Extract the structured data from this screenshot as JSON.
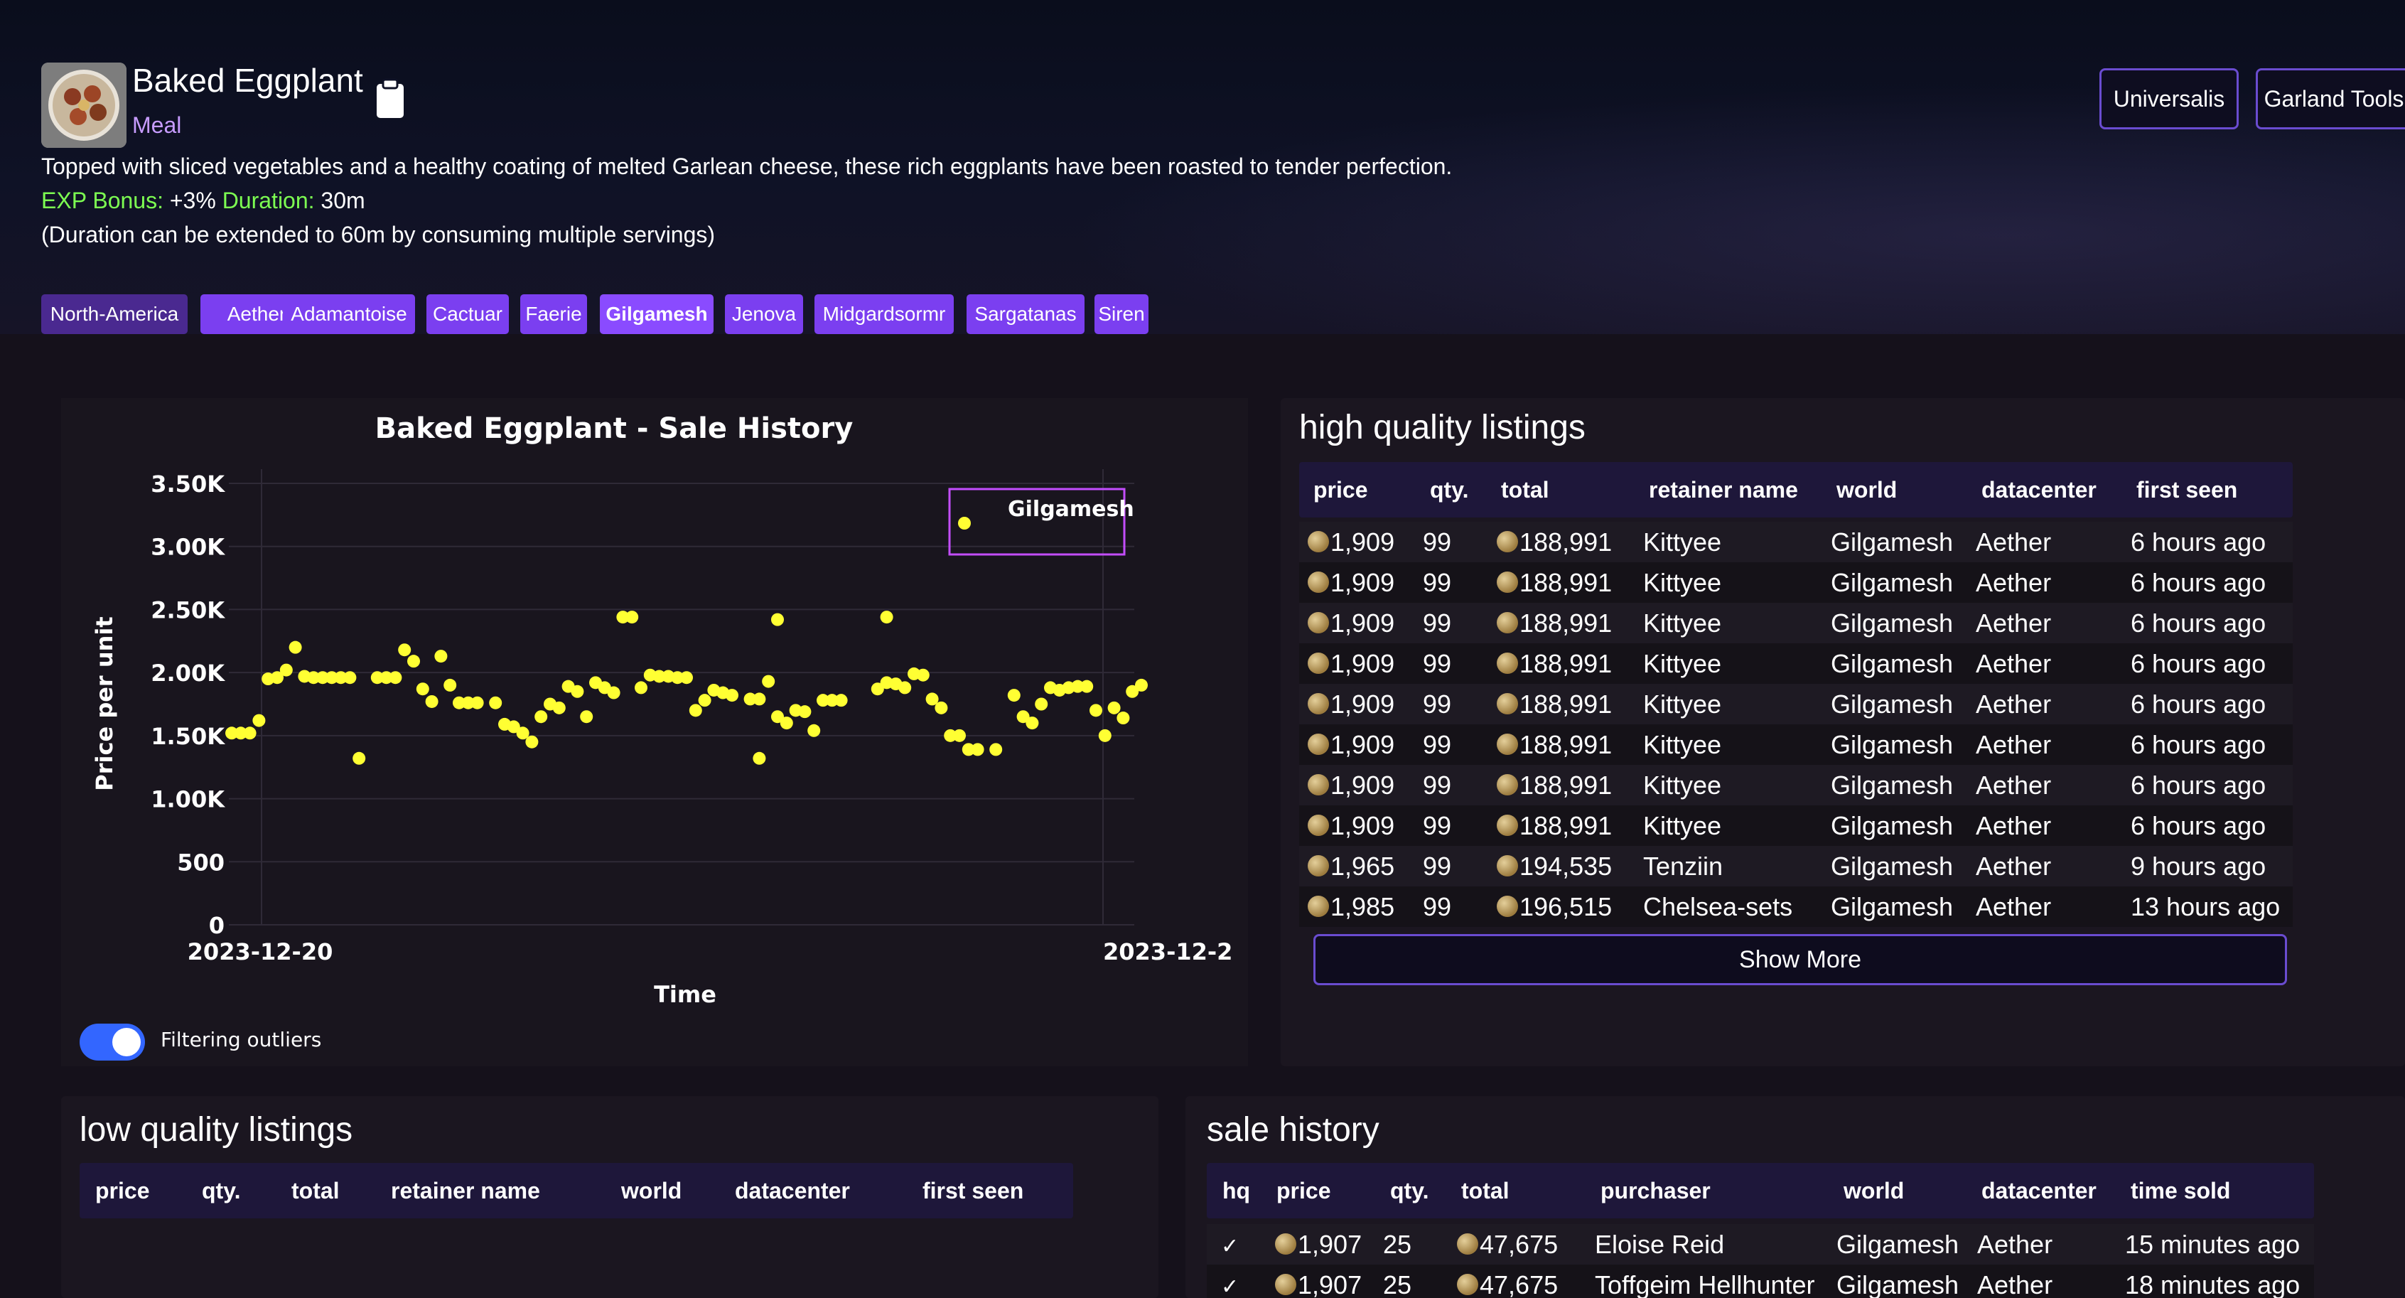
{
  "item": {
    "name": "Baked Eggplant",
    "category": "Meal",
    "description": "Topped with sliced vegetables and a healthy coating of melted Garlean cheese, these rich eggplants have been roasted to tender perfection.",
    "exp_label": "EXP Bonus:",
    "exp_value": "+3%",
    "duration_label": "Duration:",
    "duration_value": "30m",
    "duration_note": "(Duration can be extended to 60m by consuming multiple servings)"
  },
  "external_links": [
    "Universalis",
    "Garland Tools"
  ],
  "worlds": [
    {
      "label": "North-America",
      "variant": "dark"
    },
    {
      "label": "Aether",
      "variant": "normal"
    },
    {
      "label": "Adamantoise",
      "variant": "normal"
    },
    {
      "label": "Cactuar",
      "variant": "normal"
    },
    {
      "label": "Faerie",
      "variant": "normal"
    },
    {
      "label": "Gilgamesh",
      "variant": "active"
    },
    {
      "label": "Jenova",
      "variant": "normal"
    },
    {
      "label": "Midgardsormr",
      "variant": "normal"
    },
    {
      "label": "Sargatanas",
      "variant": "normal"
    },
    {
      "label": "Siren",
      "variant": "normal"
    }
  ],
  "chart": {
    "title": "Baked Eggplant - Sale History",
    "xlabel": "Time",
    "ylabel": "Price per unit",
    "yticks": [
      "3.50K",
      "3.00K",
      "2.50K",
      "2.00K",
      "1.50K",
      "1.00K",
      "500",
      "0"
    ],
    "xticks": [
      "2023-12-20",
      "2023-12-2"
    ],
    "legend": "Gilgamesh",
    "toggle_label": "Filtering outliers"
  },
  "chart_data": {
    "type": "scatter",
    "title": "Baked Eggplant - Sale History",
    "xlabel": "Time",
    "ylabel": "Price per unit",
    "ylim": [
      0,
      3500
    ],
    "series": [
      {
        "name": "Gilgamesh",
        "color": "#ffff33",
        "points": [
          [
            0.0,
            1520
          ],
          [
            0.01,
            1520
          ],
          [
            0.02,
            1520
          ],
          [
            0.03,
            1620
          ],
          [
            0.04,
            1950
          ],
          [
            0.05,
            1960
          ],
          [
            0.06,
            2020
          ],
          [
            0.07,
            2200
          ],
          [
            0.08,
            1970
          ],
          [
            0.09,
            1960
          ],
          [
            0.1,
            1960
          ],
          [
            0.11,
            1960
          ],
          [
            0.12,
            1960
          ],
          [
            0.13,
            1960
          ],
          [
            0.16,
            1960
          ],
          [
            0.17,
            1960
          ],
          [
            0.18,
            1960
          ],
          [
            0.19,
            2180
          ],
          [
            0.2,
            2090
          ],
          [
            0.21,
            1870
          ],
          [
            0.22,
            1770
          ],
          [
            0.23,
            2130
          ],
          [
            0.24,
            1900
          ],
          [
            0.25,
            1760
          ],
          [
            0.26,
            1760
          ],
          [
            0.27,
            1760
          ],
          [
            0.14,
            1320
          ],
          [
            0.29,
            1760
          ],
          [
            0.3,
            1590
          ],
          [
            0.31,
            1570
          ],
          [
            0.32,
            1520
          ],
          [
            0.33,
            1450
          ],
          [
            0.34,
            1650
          ],
          [
            0.35,
            1750
          ],
          [
            0.36,
            1720
          ],
          [
            0.37,
            1890
          ],
          [
            0.38,
            1850
          ],
          [
            0.39,
            1650
          ],
          [
            0.4,
            1920
          ],
          [
            0.41,
            1880
          ],
          [
            0.42,
            1840
          ],
          [
            0.45,
            1880
          ],
          [
            0.46,
            1980
          ],
          [
            0.47,
            1970
          ],
          [
            0.48,
            1970
          ],
          [
            0.49,
            1960
          ],
          [
            0.5,
            1960
          ],
          [
            0.51,
            1700
          ],
          [
            0.52,
            1780
          ],
          [
            0.53,
            1860
          ],
          [
            0.54,
            1840
          ],
          [
            0.55,
            1820
          ],
          [
            0.43,
            2440
          ],
          [
            0.44,
            2440
          ],
          [
            0.57,
            1790
          ],
          [
            0.58,
            1790
          ],
          [
            0.59,
            1930
          ],
          [
            0.6,
            1650
          ],
          [
            0.61,
            1600
          ],
          [
            0.62,
            1700
          ],
          [
            0.63,
            1690
          ],
          [
            0.64,
            1540
          ],
          [
            0.65,
            1780
          ],
          [
            0.66,
            1780
          ],
          [
            0.67,
            1780
          ],
          [
            0.58,
            1320
          ],
          [
            0.71,
            1870
          ],
          [
            0.72,
            1920
          ],
          [
            0.73,
            1910
          ],
          [
            0.74,
            1880
          ],
          [
            0.75,
            1990
          ],
          [
            0.76,
            1980
          ],
          [
            0.77,
            1790
          ],
          [
            0.78,
            1720
          ],
          [
            0.79,
            1500
          ],
          [
            0.8,
            1500
          ],
          [
            0.81,
            1390
          ],
          [
            0.82,
            1390
          ],
          [
            0.84,
            1390
          ],
          [
            0.86,
            1820
          ],
          [
            0.87,
            1650
          ],
          [
            0.88,
            1600
          ],
          [
            0.89,
            1750
          ],
          [
            0.9,
            1880
          ],
          [
            0.91,
            1860
          ],
          [
            0.92,
            1880
          ],
          [
            0.93,
            1890
          ],
          [
            0.94,
            1890
          ],
          [
            0.95,
            1700
          ],
          [
            0.96,
            1500
          ],
          [
            0.97,
            1720
          ],
          [
            0.98,
            1640
          ],
          [
            0.99,
            1850
          ],
          [
            1.0,
            1900
          ],
          [
            0.6,
            2420
          ],
          [
            0.72,
            2440
          ]
        ]
      }
    ]
  },
  "hq": {
    "title": "high quality listings",
    "columns": [
      "price",
      "qty.",
      "total",
      "retainer name",
      "world",
      "datacenter",
      "first seen"
    ],
    "rows": [
      [
        "1,909",
        "99",
        "188,991",
        "Kittyee",
        "Gilgamesh",
        "Aether",
        "6 hours ago"
      ],
      [
        "1,909",
        "99",
        "188,991",
        "Kittyee",
        "Gilgamesh",
        "Aether",
        "6 hours ago"
      ],
      [
        "1,909",
        "99",
        "188,991",
        "Kittyee",
        "Gilgamesh",
        "Aether",
        "6 hours ago"
      ],
      [
        "1,909",
        "99",
        "188,991",
        "Kittyee",
        "Gilgamesh",
        "Aether",
        "6 hours ago"
      ],
      [
        "1,909",
        "99",
        "188,991",
        "Kittyee",
        "Gilgamesh",
        "Aether",
        "6 hours ago"
      ],
      [
        "1,909",
        "99",
        "188,991",
        "Kittyee",
        "Gilgamesh",
        "Aether",
        "6 hours ago"
      ],
      [
        "1,909",
        "99",
        "188,991",
        "Kittyee",
        "Gilgamesh",
        "Aether",
        "6 hours ago"
      ],
      [
        "1,909",
        "99",
        "188,991",
        "Kittyee",
        "Gilgamesh",
        "Aether",
        "6 hours ago"
      ],
      [
        "1,965",
        "99",
        "194,535",
        "Tenziin",
        "Gilgamesh",
        "Aether",
        "9 hours ago"
      ],
      [
        "1,985",
        "99",
        "196,515",
        "Chelsea-sets",
        "Gilgamesh",
        "Aether",
        "13 hours ago"
      ]
    ],
    "show_more": "Show More"
  },
  "lq": {
    "title": "low quality listings",
    "columns": [
      "price",
      "qty.",
      "total",
      "retainer name",
      "world",
      "datacenter",
      "first seen"
    ]
  },
  "sales": {
    "title": "sale history",
    "columns": [
      "hq",
      "price",
      "qty.",
      "total",
      "purchaser",
      "world",
      "datacenter",
      "time sold"
    ],
    "rows": [
      [
        "✓",
        "1,907",
        "25",
        "47,675",
        "Eloise Reid",
        "Gilgamesh",
        "Aether",
        "15 minutes ago"
      ],
      [
        "✓",
        "1,907",
        "25",
        "47,675",
        "Toffgeim Hellhunter",
        "Gilgamesh",
        "Aether",
        "18 minutes ago"
      ]
    ]
  }
}
